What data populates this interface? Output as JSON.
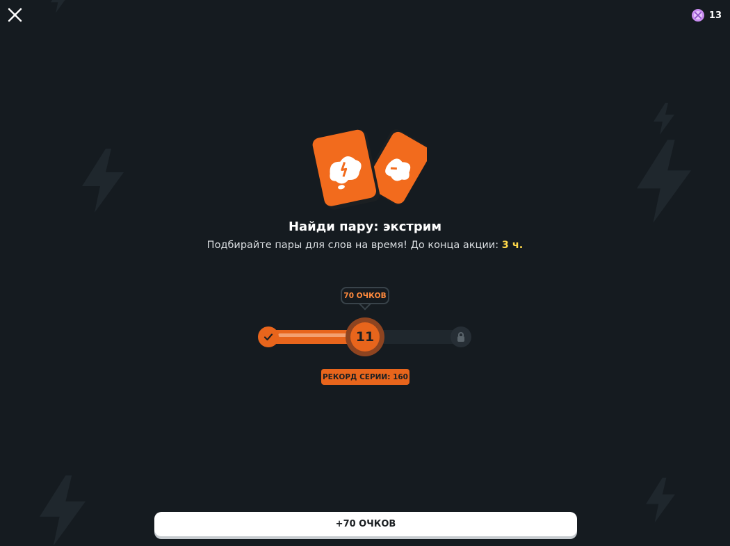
{
  "header": {
    "close_icon": "close-icon",
    "gems_icon": "gem-icon",
    "gems_count": "13"
  },
  "hero": {
    "icon": "match-cards-icon",
    "title": "Найди пару: экстрим",
    "subtitle_prefix": "Подбирайте пары для слов на время! До конца акции: ",
    "subtitle_highlight": "3 ч."
  },
  "progress": {
    "tooltip": "70 ОЧКОВ",
    "current_value": "11",
    "fill_fraction": 0.48,
    "start_icon": "check-icon",
    "end_icon": "lock-icon",
    "record_label": "РЕКОРД СЕРИИ: 160"
  },
  "footer": {
    "primary_button_label": "+70 ОЧКОВ"
  },
  "colors": {
    "background": "#151b20",
    "accent": "#e8651c",
    "highlight": "#ffd84a",
    "gem": "#c88cf0"
  }
}
